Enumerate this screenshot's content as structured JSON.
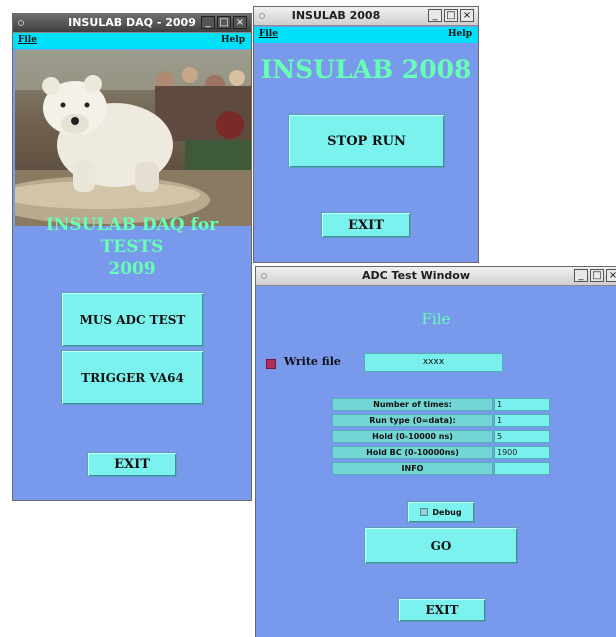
{
  "window_daq": {
    "title": "INSULAB DAQ - 2009",
    "menu_file": "File",
    "menu_help": "Help",
    "heading_line1": "INSULAB DAQ for TESTS",
    "heading_line2": "2009",
    "btn_mus_adc": "MUS ADC TEST",
    "btn_trigger": "TRIGGER VA64",
    "btn_exit": "EXIT"
  },
  "window_2008": {
    "title": "INSULAB 2008",
    "menu_file": "File",
    "menu_help": "Help",
    "heading": "INSULAB 2008",
    "btn_stop": "STOP RUN",
    "btn_exit": "EXIT"
  },
  "window_adc": {
    "title": "ADC Test Window",
    "heading": "File",
    "write_file_label": "Write file",
    "filename": "xxxx",
    "params": [
      {
        "label": "Number of times:",
        "value": "1"
      },
      {
        "label": "Run type (0=data):",
        "value": "1"
      },
      {
        "label": "Hold (0-10000 ns)",
        "value": "5"
      },
      {
        "label": "Hold BC (0-10000ns)",
        "value": "1900"
      },
      {
        "label": "INFO",
        "value": ""
      }
    ],
    "debug_label": "Debug",
    "btn_go": "GO",
    "btn_exit": "EXIT"
  },
  "colors": {
    "window_bg": "#7899ec",
    "menubar": "#00e0f8",
    "button": "#7cf2ef",
    "heading": "#66ffb4",
    "checkbox": "#b0305a"
  },
  "window_buttons": {
    "minimize": "_",
    "maximize": "□",
    "close": "×"
  }
}
